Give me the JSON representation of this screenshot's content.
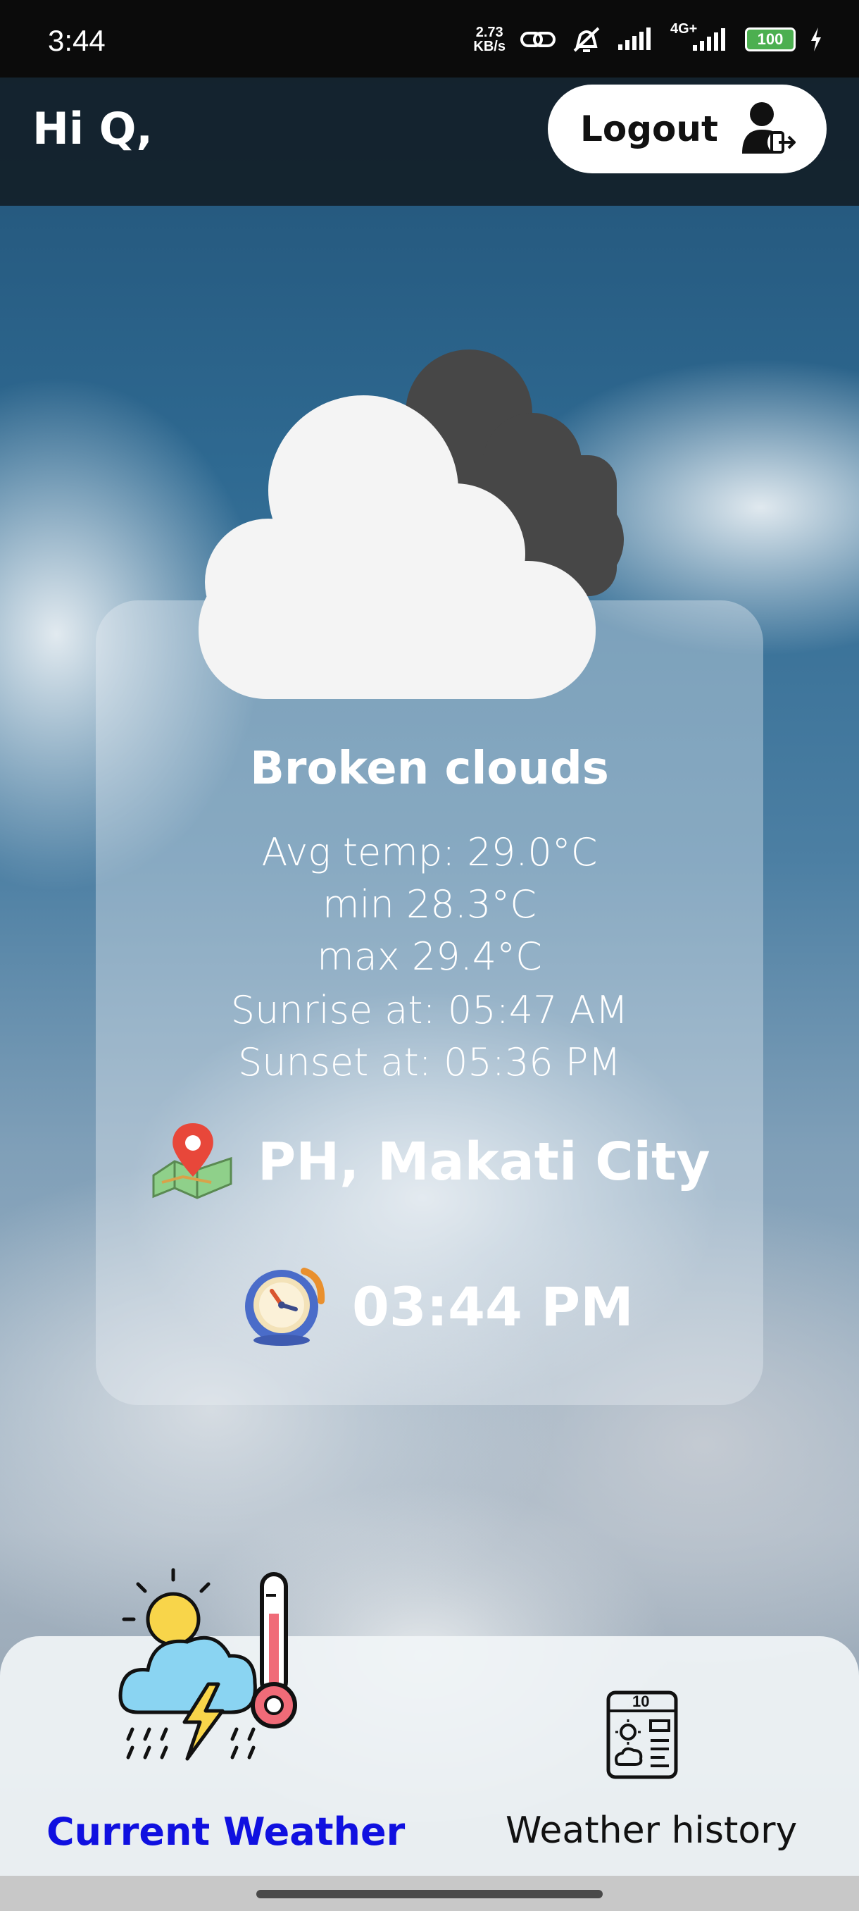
{
  "status_bar": {
    "time": "3:44",
    "net_speed_value": "2.73",
    "net_speed_unit": "KB/s",
    "network_type": "4G+",
    "battery": "100"
  },
  "header": {
    "greeting": "Hi Q,",
    "logout_label": "Logout"
  },
  "weather": {
    "condition": "Broken clouds",
    "avg_temp": "Avg temp: 29.0°C",
    "min_temp": "min 28.3°C",
    "max_temp": "max 29.4°C",
    "sunrise": "Sunrise at: 05:47 AM",
    "sunset": "Sunset at: 05:36 PM",
    "location": "PH, Makati City",
    "time": "03:44 PM"
  },
  "nav": {
    "current_label": "Current Weather",
    "history_label": "Weather history",
    "history_icon_number": "10",
    "active": "Current Weather",
    "active_color": "#1010e0"
  },
  "icons": {
    "status": [
      "link-icon",
      "mute-icon",
      "signal-icon",
      "signal-4g-icon",
      "battery-icon",
      "charging-icon"
    ],
    "logout": "logout-user-icon",
    "weather": "broken-clouds-icon",
    "location": "map-pin-icon",
    "clock": "clock-icon",
    "nav_current": "thunderstorm-thermometer-icon",
    "nav_history": "weather-history-icon"
  }
}
